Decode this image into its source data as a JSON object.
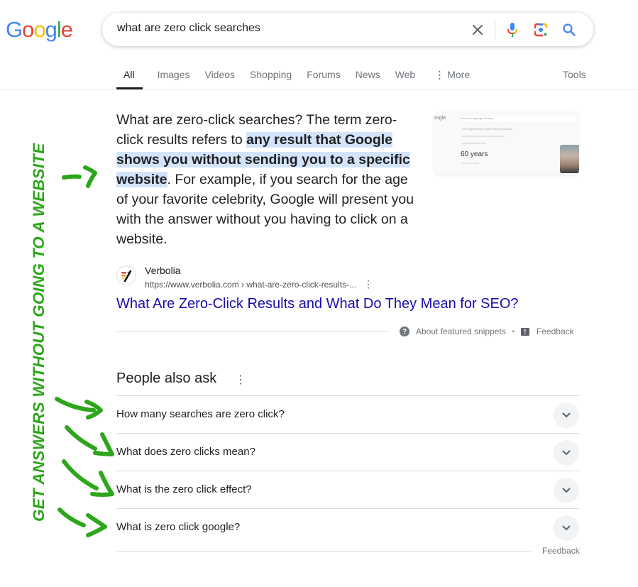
{
  "header": {
    "logo": [
      "G",
      "o",
      "o",
      "g",
      "l",
      "e"
    ],
    "logo_colors": [
      "#4285f4",
      "#ea4335",
      "#fbbc05",
      "#4285f4",
      "#34a853",
      "#ea4335"
    ],
    "search_query": "what are zero click searches",
    "icons": [
      "clear-icon",
      "microphone-icon",
      "google-lens-icon",
      "search-icon"
    ]
  },
  "tabs": {
    "items": [
      "All",
      "Images",
      "Videos",
      "Shopping",
      "Forums",
      "News",
      "Web"
    ],
    "active": "All",
    "more_label": "More",
    "tools_label": "Tools"
  },
  "featured_snippet": {
    "text_before": "What are zero-click searches? The term zero-click results refers to ",
    "text_highlight": "any result that Google shows you without sending you to a specific website",
    "text_after": ". For example, if you search for the age of your favorite celebrity, Google will present you with the answer without you having to click on a website.",
    "highlight_color": "#d2e3fc",
    "thumbnail": {
      "logo": "oogle",
      "query": "how old is george clooney",
      "tabs": "All   Images   News   Videos   Shopping   More",
      "age": "60 years"
    },
    "source": {
      "name": "Verbolia",
      "url": "https://www.verbolia.com › what-are-zero-click-results-...",
      "title": "What Are Zero-Click Results and What Do They Mean for SEO?"
    },
    "about_label": "About featured snippets",
    "feedback_label": "Feedback"
  },
  "people_also_ask": {
    "title": "People also ask",
    "questions": [
      "How many searches are zero click?",
      "What does zero clicks mean?",
      "What is the zero click effect?",
      "What is zero click google?"
    ],
    "feedback_label": "Feedback"
  },
  "annotation": {
    "text": "GET ANSWERS WITHOUT GOING TO A WEBSITE",
    "color": "#2ca61a"
  }
}
